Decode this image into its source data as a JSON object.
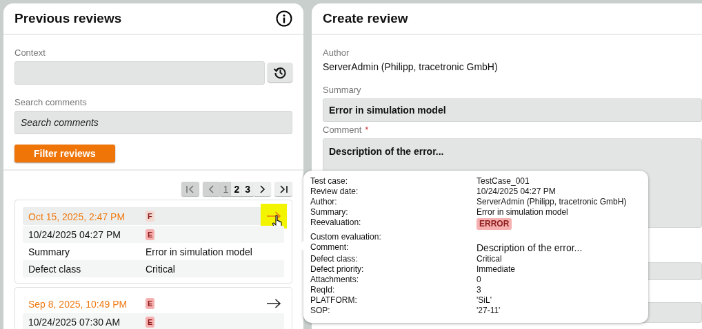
{
  "previous_reviews": {
    "title": "Previous reviews",
    "context": {
      "label": "Context"
    },
    "search": {
      "label": "Search comments",
      "placeholder": "Search comments"
    },
    "filter_button": "Filter reviews",
    "pagination": {
      "first_disabled": true,
      "prev_disabled": true,
      "pages": [
        {
          "label": "1",
          "selected": true
        },
        {
          "label": "2",
          "selected": false
        },
        {
          "label": "3",
          "selected": false
        }
      ]
    },
    "reviews": [
      {
        "date": "Oct 15, 2025, 2:47 PM",
        "badge": "F",
        "color": "#f4d9d2",
        "hovered": true,
        "rows": [
          {
            "label": "10/24/2025 04:27 PM",
            "badge": "E",
            "color": "#f7b0b0"
          },
          {
            "label": "Summary",
            "value": "Error in simulation model"
          },
          {
            "label": "Defect class",
            "value": "Critical"
          }
        ]
      },
      {
        "date": "Sep 8, 2025, 10:49 PM",
        "badge": "E",
        "color": "#f7b0b0",
        "hovered": false,
        "rows": [
          {
            "label": "10/24/2025 07:30 AM",
            "badge": "E",
            "color": "#f7b0b0"
          }
        ]
      }
    ]
  },
  "create_review": {
    "title": "Create review",
    "author": {
      "label": "Author",
      "value": "ServerAdmin (Philipp, tracetronic GmbH)"
    },
    "summary": {
      "label": "Summary",
      "value": "Error in simulation model"
    },
    "comment": {
      "label": "Comment",
      "required_mark": "*",
      "value": "Description of the error..."
    }
  },
  "tooltip": {
    "rows": [
      {
        "label": "Test case:",
        "value": "TestCase_001",
        "kind": "text"
      },
      {
        "label": "Review date:",
        "value": "10/24/2025 04:27 PM",
        "kind": "text"
      },
      {
        "label": "Author:",
        "value": "ServerAdmin (Philipp, tracetronic GmbH)",
        "kind": "text"
      },
      {
        "label": "Summary:",
        "value": "Error in simulation model",
        "kind": "text"
      },
      {
        "label": "Reevaluation:",
        "value": "ERROR",
        "kind": "badge"
      },
      {
        "label": "Custom evaluation:",
        "kind": "text"
      },
      {
        "label": "Comment:",
        "value": "Description of the error...",
        "kind": "large"
      },
      {
        "label": "Defect class:",
        "value": "Critical",
        "kind": "text"
      },
      {
        "label": "Defect priority:",
        "value": "Immediate",
        "kind": "text"
      },
      {
        "label": "Attachments:",
        "value": "0",
        "kind": "text"
      },
      {
        "label": "ReqId:",
        "value": "3",
        "kind": "text"
      },
      {
        "label": "PLATFORM:",
        "value": "'SiL'",
        "kind": "text"
      },
      {
        "label": "SOP:",
        "value": "'27-11'",
        "kind": "text"
      }
    ]
  }
}
